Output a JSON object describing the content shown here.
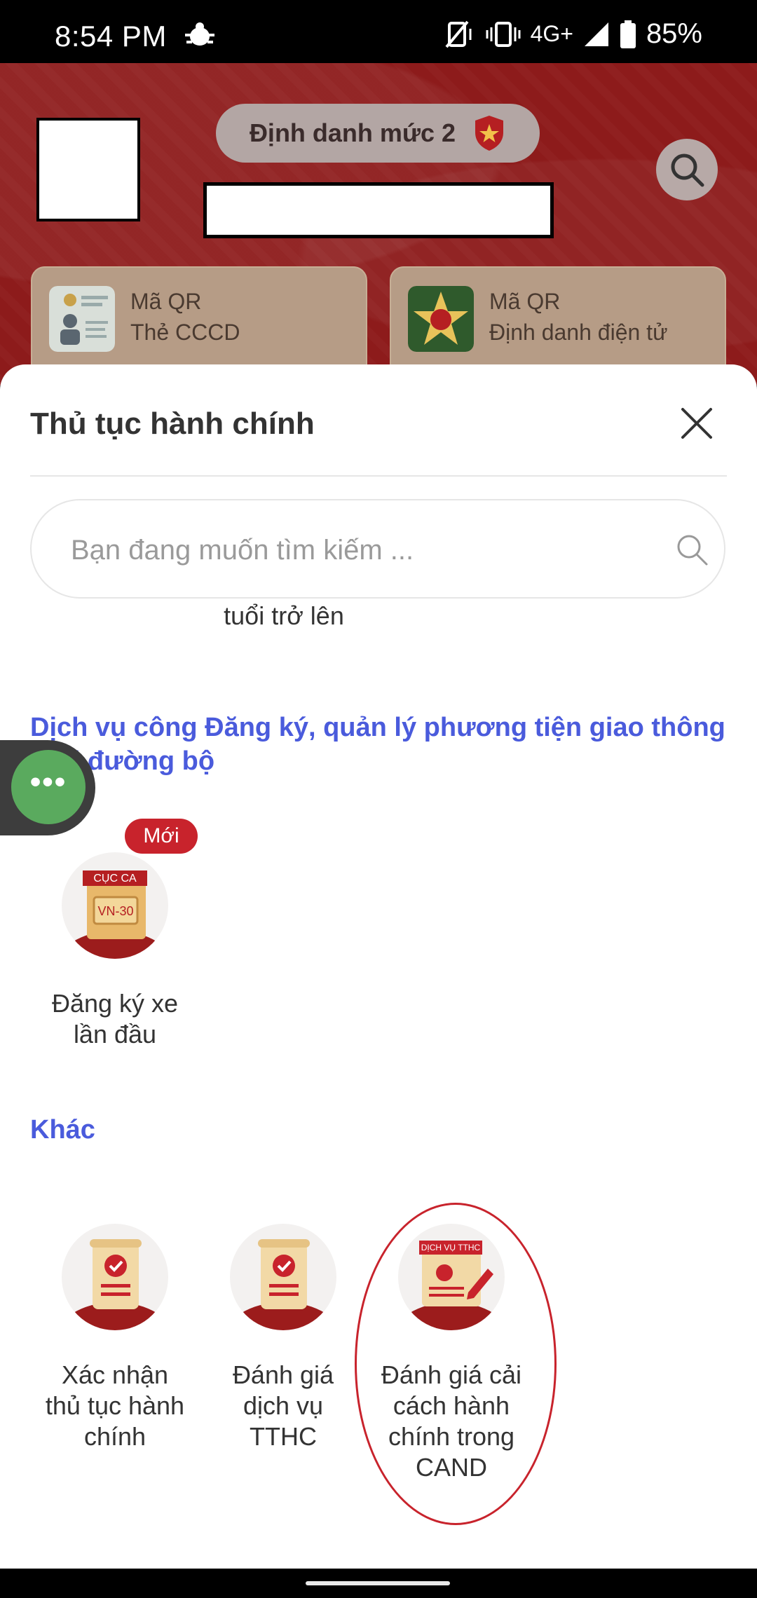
{
  "status_bar": {
    "time": "8:54 PM",
    "network": "4G+",
    "battery": "85%"
  },
  "header": {
    "level_badge": "Định danh mức 2",
    "qr_cards": [
      {
        "line1": "Mã QR",
        "line2": "Thẻ CCCD"
      },
      {
        "line1": "Mã QR",
        "line2": "Định danh điện tử"
      }
    ]
  },
  "sheet": {
    "title": "Thủ tục hành chính",
    "search_placeholder": "Bạn đang muốn tìm kiếm ...",
    "partial_item_label": "tuổi trở lên",
    "sections": [
      {
        "title": "Dịch vụ công Đăng ký, quản lý phương tiện giao thông giới đường bộ",
        "items": [
          {
            "label_line1": "Đăng ký xe",
            "label_line2": "lần đầu",
            "badge": "Mới",
            "icon": "license-plate-icon",
            "icon_text_top": "CỤC CA",
            "icon_text_plate": "VN-30"
          }
        ]
      },
      {
        "title": "Khác",
        "items": [
          {
            "lines": [
              "Xác nhận",
              "thủ tục hành",
              "chính"
            ],
            "icon": "document-check-icon"
          },
          {
            "lines": [
              "Đánh giá",
              "dịch vụ",
              "TTHC"
            ],
            "icon": "document-check-icon"
          },
          {
            "lines": [
              "Đánh giá cải",
              "cách hành",
              "chính trong",
              "CAND"
            ],
            "icon": "service-review-icon",
            "icon_text": "DỊCH VỤ TTHC"
          }
        ]
      }
    ]
  },
  "fab": {
    "label": "•••"
  },
  "colors": {
    "header_red": "#8d1b1b",
    "accent_blue": "#4a5bdc",
    "badge_red": "#c8232c",
    "fab_green": "#5aaa5e"
  }
}
